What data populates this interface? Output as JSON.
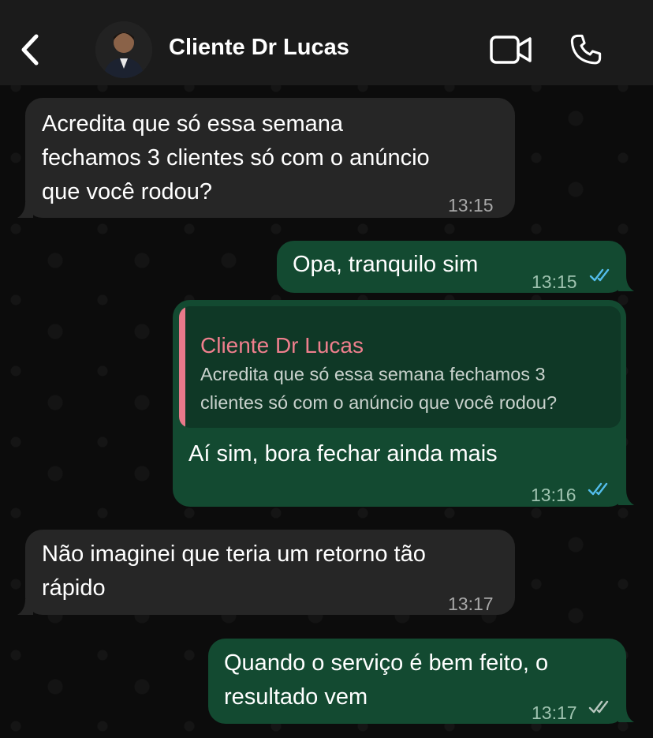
{
  "header": {
    "title": "Cliente Dr Lucas",
    "back_icon": "chevron-left-icon",
    "video_icon": "video-camera-icon",
    "call_icon": "phone-icon"
  },
  "colors": {
    "incoming_bubble": "#262626",
    "outgoing_bubble": "#134a31",
    "read_ticks": "#53bdeb",
    "quote_author": "#ef7f8d"
  },
  "messages": [
    {
      "direction": "incoming",
      "lines": [
        "Acredita que só essa semana",
        "fechamos 3 clientes só com o anúncio",
        "que você rodou?"
      ],
      "time": "13:15"
    },
    {
      "direction": "outgoing",
      "lines": [
        "Opa, tranquilo sim"
      ],
      "time": "13:15",
      "status": "read"
    },
    {
      "direction": "outgoing",
      "quote": {
        "author": "Cliente Dr Lucas",
        "lines": [
          "Acredita que só essa semana fechamos 3",
          "clientes só com o anúncio que você rodou?"
        ]
      },
      "lines": [
        "Aí sim, bora fechar ainda mais"
      ],
      "time": "13:16",
      "status": "read"
    },
    {
      "direction": "incoming",
      "lines": [
        "Não imaginei que teria um retorno tão",
        "rápido"
      ],
      "time": "13:17"
    },
    {
      "direction": "outgoing",
      "lines": [
        "Quando o serviço é bem feito, o",
        "resultado vem"
      ],
      "time": "13:17",
      "status": "delivered"
    }
  ]
}
